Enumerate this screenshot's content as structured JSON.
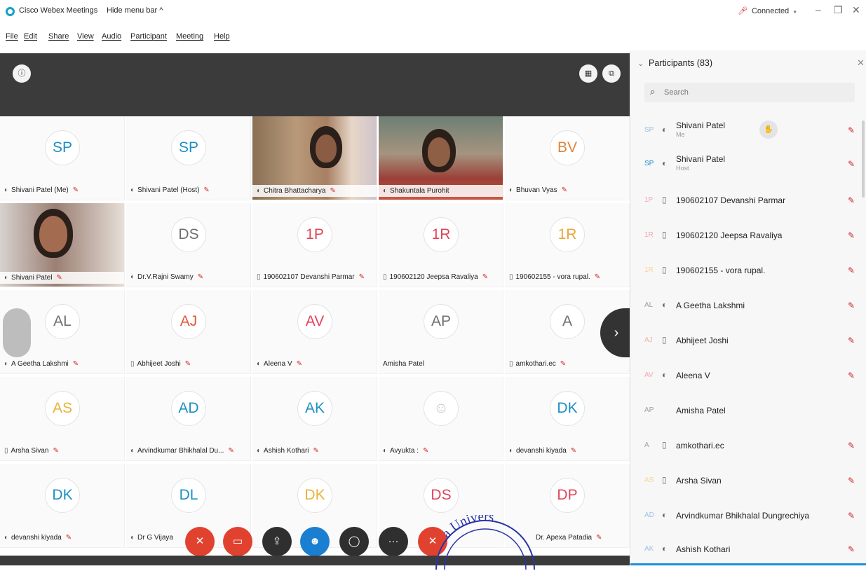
{
  "titlebar": {
    "app_name": "Cisco Webex Meetings",
    "hide_menu": "Hide menu bar ^",
    "status": "Connected"
  },
  "menu": {
    "items": [
      "File",
      "Edit",
      "Share",
      "View",
      "Audio",
      "Participant",
      "Meeting",
      "Help"
    ]
  },
  "grid": {
    "row1": [
      {
        "initials": "SP",
        "name": "Shivani Patel (Me)"
      },
      {
        "initials": "SP",
        "name": "Shivani Patel (Host)"
      },
      {
        "name": "Chitra Bhattacharya"
      },
      {
        "name": "Shakuntala Purohit"
      },
      {
        "initials": "BV",
        "name": "Bhuvan Vyas"
      }
    ],
    "row2": [
      {
        "name": "Shivani Patel"
      },
      {
        "initials": "DS",
        "name": "Dr.V.Rajni Swamy"
      },
      {
        "initials": "1P",
        "name": "190602107 Devanshi Parmar"
      },
      {
        "initials": "1R",
        "name": "190602120 Jeepsa Ravaliya"
      },
      {
        "initials": "1R",
        "name": "190602155 - vora rupal."
      }
    ],
    "row3": [
      {
        "initials": "AL",
        "name": "A Geetha Lakshmi"
      },
      {
        "initials": "AJ",
        "name": "Abhijeet Joshi"
      },
      {
        "initials": "AV",
        "name": "Aleena V"
      },
      {
        "initials": "AP",
        "name": "Amisha Patel"
      },
      {
        "initials": "A",
        "name": "amkothari.ec"
      }
    ],
    "row4": [
      {
        "initials": "AS",
        "name": "Arsha Sivan"
      },
      {
        "initials": "AD",
        "name": "Arvindkumar Bhikhalal Du..."
      },
      {
        "initials": "AK",
        "name": "Ashish Kothari"
      },
      {
        "initials": "",
        "name": "Avyukta :"
      },
      {
        "initials": "DK",
        "name": "devanshi kiyada"
      }
    ],
    "row5": [
      {
        "initials": "DK",
        "name": "devanshi kiyada"
      },
      {
        "initials": "DL",
        "name": "Dr G Vijaya"
      },
      {
        "initials": "DK",
        "name": ""
      },
      {
        "initials": "DS",
        "name": ""
      },
      {
        "initials": "DP",
        "name": "Dr. Apexa Patadia"
      }
    ]
  },
  "colors": {
    "SP": "#1d8fc4",
    "BV": "#e0843a",
    "DS": "#6f6f6f",
    "1P": "#e0445a",
    "1R": "#e0445a",
    "1R2": "#e8a73a",
    "AL": "#6f6f6f",
    "AJ": "#e05a3a",
    "AV": "#e0445a",
    "AP": "#6f6f6f",
    "A": "#6f6f6f",
    "AS": "#e8b43a",
    "AD": "#1d8fc4",
    "AK": "#1d8fc4",
    "DK": "#1d8fc4",
    "DL": "#1d8fc4",
    "DK2": "#e8b43a",
    "DS2": "#e0445a",
    "DP": "#e0445a",
    "mic_red": "#d2232a",
    "accent": "#1a8fd6"
  },
  "controls": {
    "mute_icon": "mic-off-icon",
    "video_icon": "video-off-icon",
    "share_icon": "share-icon",
    "participants_icon": "participants-icon",
    "chat_icon": "chat-icon",
    "more_icon": "more-icon",
    "leave_icon": "leave-icon"
  },
  "stamp": {
    "text": "a Univers"
  },
  "participants_panel": {
    "title": "Participants (83)",
    "search_placeholder": "Search",
    "rows": [
      {
        "initials": "SP",
        "name": "Shivani Patel",
        "sub": "Me"
      },
      {
        "initials": "SP",
        "name": "Shivani Patel",
        "sub": "Host"
      },
      {
        "initials": "1P",
        "name": "190602107 Devanshi Parmar"
      },
      {
        "initials": "1R",
        "name": "190602120 Jeepsa Ravaliya"
      },
      {
        "initials": "1R",
        "name": "190602155 - vora rupal."
      },
      {
        "initials": "AL",
        "name": "A Geetha Lakshmi"
      },
      {
        "initials": "AJ",
        "name": "Abhijeet Joshi"
      },
      {
        "initials": "AV",
        "name": "Aleena V"
      },
      {
        "initials": "AP",
        "name": "Amisha Patel"
      },
      {
        "initials": "A",
        "name": "amkothari.ec"
      },
      {
        "initials": "AS",
        "name": "Arsha Sivan"
      },
      {
        "initials": "AD",
        "name": "Arvindkumar Bhikhalal Dungrechiya"
      },
      {
        "initials": "AK",
        "name": "Ashish Kothari"
      }
    ]
  }
}
